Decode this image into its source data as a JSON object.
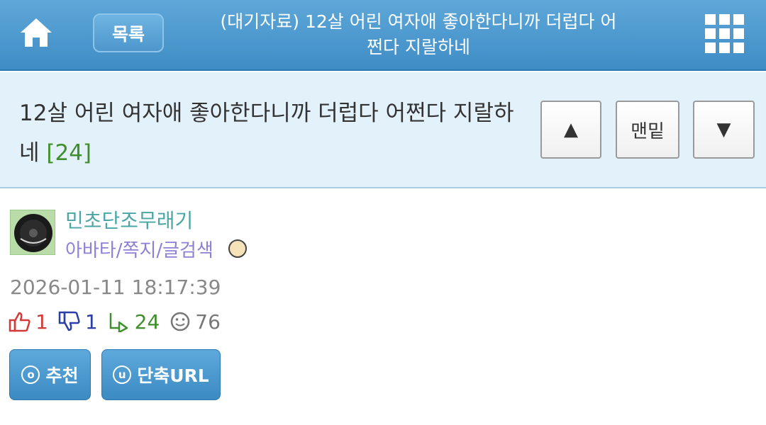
{
  "header": {
    "list_label": "목록",
    "title": "(대기자료) 12살 어린 여자애 좋아한다니까 더럽다 어쩐다 지랄하네",
    "home_icon": "home-icon",
    "menu_icon": "grid-menu-icon"
  },
  "post": {
    "subject": "12살 어린 여자애 좋아한다니까 더럽다 어쩐다 지랄하네",
    "comment_count": "[24]",
    "nav": {
      "up_icon": "▲",
      "bottom_label": "맨밑",
      "down_icon": "▼"
    }
  },
  "author": {
    "name": "민초단조무래기",
    "links": "아바타/쪽지/글검색",
    "timestamp": "2026-01-11 18:17:39"
  },
  "stats": {
    "upvotes": "1",
    "downvotes": "1",
    "replies": "24",
    "views": "76"
  },
  "actions": {
    "recommend_label": "추천",
    "short_url_label": "단축URL"
  },
  "colors": {
    "header_blue": "#3f8dc6",
    "subject_band": "#e3f1fb",
    "comment_count_green": "#3f8f2c",
    "author_teal": "#4aa6a6",
    "links_purple": "#8f7fd6"
  }
}
